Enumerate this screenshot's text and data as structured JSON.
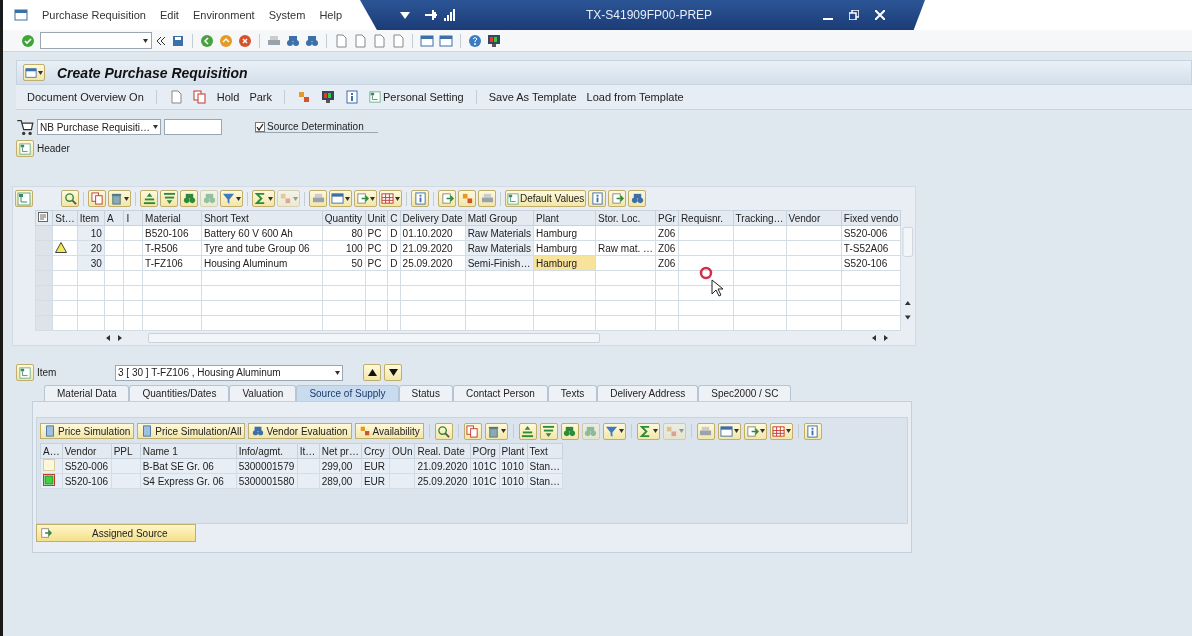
{
  "menu": [
    "Purchase Requisition",
    "Edit",
    "Environment",
    "System",
    "Help"
  ],
  "window_title": "TX-S41909FP00-PREP",
  "screen_title": "Create Purchase Requisition",
  "app_toolbar": [
    "Document Overview On",
    "Hold",
    "Park",
    "Personal Setting",
    "Save As Template",
    "Load from Template"
  ],
  "document_type": {
    "value": "NB Purchase Requisiti…"
  },
  "source_determination": {
    "label": "Source Determination",
    "checked": true
  },
  "header_label": "Header",
  "items_toolbar_button": "Default Values",
  "items_columns": [
    "St…",
    "Item",
    "A",
    "I",
    "Material",
    "Short Text",
    "Quantity",
    "Unit",
    "C",
    "Delivery Date",
    "Matl Group",
    "Plant",
    "Stor. Loc.",
    "PGr",
    "Requisnr.",
    "Tracking…",
    "Vendor",
    "Fixed vendo"
  ],
  "items": [
    {
      "warning": false,
      "item": "10",
      "material": "B520-106",
      "short_text": "Battery 60 V 600 Ah",
      "quantity": "80",
      "unit": "PC",
      "c": "D",
      "delivery_date": "01.10.2020",
      "matl_group": "Raw Materials",
      "plant": "Hamburg",
      "plant_focused": false,
      "pgr": "Z06",
      "fixed_vendor": "S520-006"
    },
    {
      "warning": true,
      "item": "20",
      "material": "T-R506",
      "short_text": "Tyre and tube Group 06",
      "quantity": "100",
      "unit": "PC",
      "c": "D",
      "delivery_date": "21.09.2020",
      "matl_group": "Raw Materials",
      "plant": "Hamburg",
      "plant_focused": false,
      "stor_loc": "Raw mat. …",
      "pgr": "Z06",
      "fixed_vendor": "T-S52A06"
    },
    {
      "warning": false,
      "item": "30",
      "material": "T-FZ106",
      "short_text": "Housing Aluminum",
      "quantity": "50",
      "unit": "PC",
      "c": "D",
      "delivery_date": "25.09.2020",
      "matl_group": "Semi-Finish…",
      "plant": "Hamburg",
      "plant_focused": true,
      "pgr": "Z06",
      "fixed_vendor": "S520-106"
    }
  ],
  "item_selector": {
    "label": "Item",
    "value": "3 [ 30 ] T-FZ106 , Housing Aluminum"
  },
  "tabs": [
    {
      "label": "Material Data",
      "selected": false
    },
    {
      "label": "Quantities/Dates",
      "selected": false
    },
    {
      "label": "Valuation",
      "selected": false
    },
    {
      "label": "Source of Supply",
      "selected": true
    },
    {
      "label": "Status",
      "selected": false
    },
    {
      "label": "Contact Person",
      "selected": false
    },
    {
      "label": "Texts",
      "selected": false
    },
    {
      "label": "Delivery Address",
      "selected": false
    },
    {
      "label": "Spec2000 / SC",
      "selected": false
    }
  ],
  "source_buttons": [
    "Price Simulation",
    "Price Simulation/All",
    "Vendor Evaluation",
    "Availability"
  ],
  "sources_columns": [
    "A…",
    "Vendor",
    "PPL",
    "Name 1",
    "Info/agmt.",
    "It…",
    "Net pr…",
    "Crcy",
    "OUn",
    "Real. Date",
    "POrg",
    "Plant",
    "Text"
  ],
  "sources": [
    {
      "assigned": false,
      "vendor": "S520-006",
      "name": "B-Bat SE Gr. 06",
      "info": "5300001579",
      "net_price": "299,00",
      "currency": "EUR",
      "date": "21.09.2020",
      "porg": "101C",
      "plant": "1010",
      "text": "Stan…"
    },
    {
      "assigned": true,
      "vendor": "S520-106",
      "name": "S4 Express Gr. 06",
      "info": "5300001580",
      "net_price": "289,00",
      "currency": "EUR",
      "date": "25.09.2020",
      "porg": "101C",
      "plant": "1010",
      "text": "Stan…"
    }
  ],
  "assigned_source_button": "Assigned Source"
}
